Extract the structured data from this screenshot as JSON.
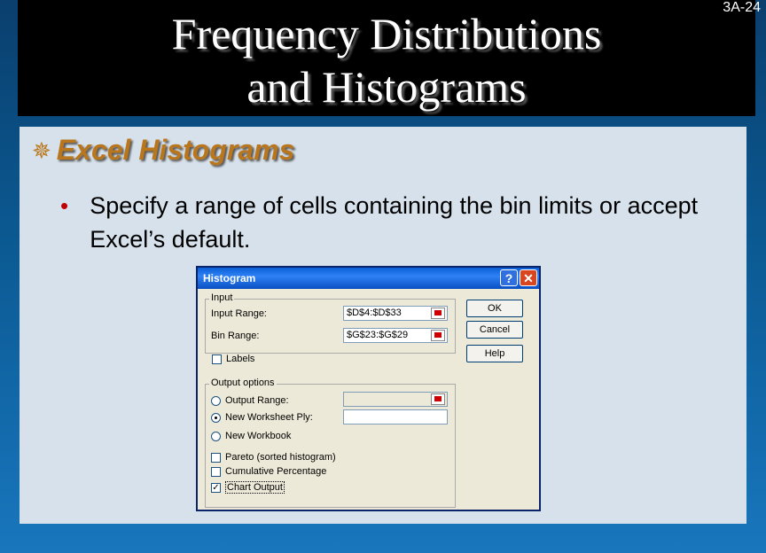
{
  "slide": {
    "title_line1": "Frequency Distributions",
    "title_line2": "and Histograms",
    "slide_number": "3A-24",
    "heading": "Excel Histograms",
    "heading_icon": "compass-star-icon",
    "bullet": "Specify a range of cells containing the bin limits or accept Excel’s default.",
    "colors": {
      "title_bg": "#000000",
      "heading": "#b9761c",
      "bullet_dot": "#c00000",
      "content_bg": "#d6e1eb"
    }
  },
  "dialog": {
    "title": "Histogram",
    "help_glyph": "?",
    "close_glyph": "✕",
    "input_group": "Input",
    "input_range_label": "Input Range:",
    "input_range_value": "$D$4:$D$33",
    "bin_range_label": "Bin Range:",
    "bin_range_value": "$G$23:$G$29",
    "labels_label": "Labels",
    "output_group": "Output options",
    "output_range_label": "Output Range:",
    "output_range_value": "",
    "new_worksheet_label": "New Worksheet Ply:",
    "new_worksheet_value": "",
    "new_workbook_label": "New Workbook",
    "pareto_label": "Pareto (sorted histogram)",
    "cumulative_label": "Cumulative Percentage",
    "chart_output_label": "Chart Output",
    "ok_label": "OK",
    "cancel_label": "Cancel",
    "help_label": "Help",
    "check_glyph": "✓"
  }
}
